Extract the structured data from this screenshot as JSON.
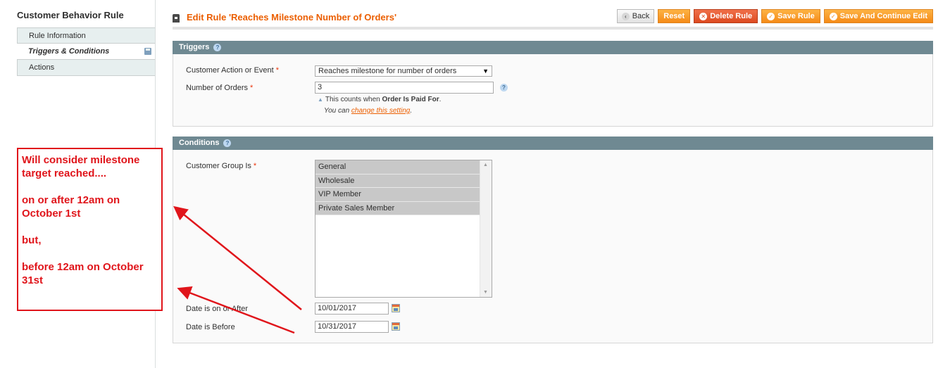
{
  "sidebar": {
    "title": "Customer Behavior Rule",
    "tabs": [
      {
        "label": "Rule Information"
      },
      {
        "label": "Triggers & Conditions"
      },
      {
        "label": "Actions"
      }
    ]
  },
  "header": {
    "title": "Edit Rule 'Reaches Milestone Number of Orders'",
    "buttons": {
      "back": "Back",
      "reset": "Reset",
      "delete": "Delete Rule",
      "save": "Save Rule",
      "save_continue": "Save And Continue Edit"
    }
  },
  "triggers": {
    "heading": "Triggers",
    "action_label": "Customer Action or Event",
    "action_value": "Reaches milestone for number of orders",
    "orders_label": "Number of Orders",
    "orders_value": "3",
    "note_prefix": "This counts when ",
    "note_bold": "Order Is Paid For",
    "note_suffix": ".",
    "note2_prefix": "You can ",
    "note2_link": "change this setting",
    "note2_suffix": "."
  },
  "conditions": {
    "heading": "Conditions",
    "group_label": "Customer Group Is",
    "groups": [
      "General",
      "Wholesale",
      "VIP Member",
      "Private Sales Member"
    ],
    "date_after_label": "Date is on or After",
    "date_after_value": "10/01/2017",
    "date_before_label": "Date is Before",
    "date_before_value": "10/31/2017"
  },
  "annotation": {
    "lines": [
      "Will consider milestone",
      "target reached....",
      "",
      "on or after 12am on",
      "October 1st",
      "",
      "but,",
      "",
      "before 12am on October",
      "31st"
    ],
    "color": "#e0151b"
  },
  "colors": {
    "accent": "#eb5e00",
    "button": "#f58a17",
    "section_header": "#6f8992"
  }
}
